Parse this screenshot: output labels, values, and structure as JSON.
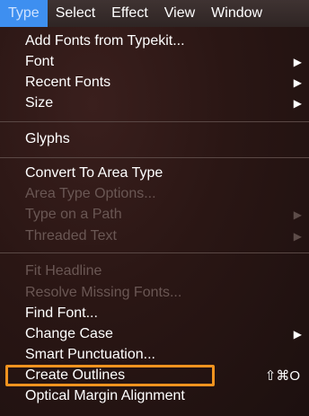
{
  "menubar": {
    "items": [
      {
        "label": "Type",
        "active": true
      },
      {
        "label": "Select"
      },
      {
        "label": "Effect"
      },
      {
        "label": "View"
      },
      {
        "label": "Window"
      }
    ]
  },
  "menu": {
    "add_fonts": "Add Fonts from Typekit...",
    "font": "Font",
    "recent_fonts": "Recent Fonts",
    "size": "Size",
    "glyphs": "Glyphs",
    "convert_area_type": "Convert To Area Type",
    "area_type_options": "Area Type Options...",
    "type_on_path": "Type on a Path",
    "threaded_text": "Threaded Text",
    "fit_headline": "Fit Headline",
    "resolve_missing_fonts": "Resolve Missing Fonts...",
    "find_font": "Find Font...",
    "change_case": "Change Case",
    "smart_punctuation": "Smart Punctuation...",
    "create_outlines": "Create Outlines",
    "create_outlines_shortcut": "⇧⌘O",
    "optical_margin_alignment": "Optical Margin Alignment",
    "submenu_arrow": "▶"
  },
  "colors": {
    "highlight_box": "#f0931f",
    "active_menu": "#3e8ff0"
  }
}
